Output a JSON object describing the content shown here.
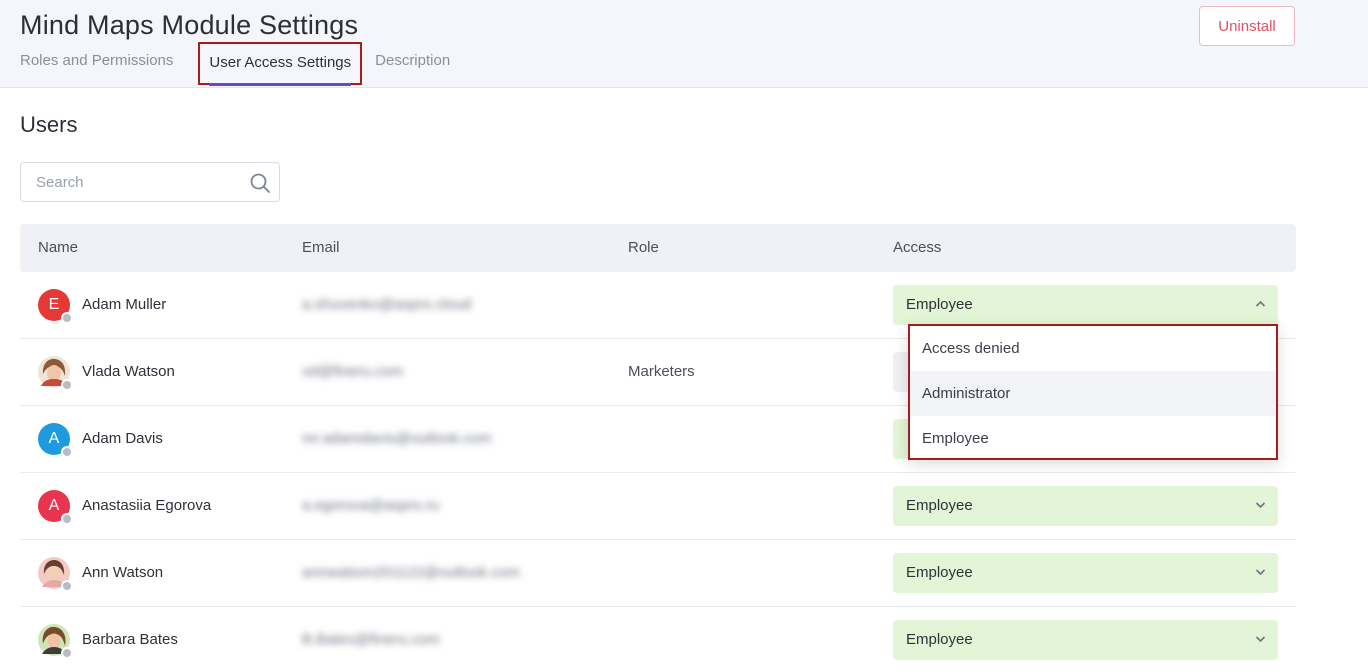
{
  "header": {
    "title": "Mind Maps Module Settings",
    "uninstall_label": "Uninstall",
    "tabs": [
      {
        "label": "Roles and Permissions",
        "active": false
      },
      {
        "label": "User Access Settings",
        "active": true
      },
      {
        "label": "Description",
        "active": false
      }
    ]
  },
  "users_section": {
    "title": "Users",
    "search_placeholder": "Search"
  },
  "table": {
    "columns": [
      "Name",
      "Email",
      "Role",
      "Access"
    ],
    "rows": [
      {
        "name": "Adam Muller",
        "avatar_letter": "E",
        "avatar_color": "#e53935",
        "email": "a.shuvenko@aspro.cloud",
        "role": "",
        "access": "Employee"
      },
      {
        "name": "Vlada Watson",
        "avatar_letter": "",
        "avatar_color": "#d9a38a",
        "email": "vd@fineru.com",
        "role": "Marketers",
        "access": ""
      },
      {
        "name": "Adam Davis",
        "avatar_letter": "A",
        "avatar_color": "#1e9be0",
        "email": "mr.adamdavis@outlook.com",
        "role": "",
        "access": ""
      },
      {
        "name": "Anastasiia Egorova",
        "avatar_letter": "A",
        "avatar_color": "#e8344e",
        "email": "a.egorova@aspro.ru",
        "role": "",
        "access": "Employee"
      },
      {
        "name": "Ann Watson",
        "avatar_letter": "",
        "avatar_color": "#e8a0a0",
        "email": "annwatson201122@outlook.com",
        "role": "",
        "access": "Employee"
      },
      {
        "name": "Barbara Bates",
        "avatar_letter": "",
        "avatar_color": "#8a6a4a",
        "email": "B.Bates@fineru.com",
        "role": "",
        "access": "Employee"
      }
    ]
  },
  "dropdown": {
    "options": [
      "Access denied",
      "Administrator",
      "Employee"
    ],
    "hovered": "Administrator"
  },
  "colors": {
    "accent_tab_underline": "#6c4bb8",
    "highlight_border": "#a71d1d",
    "uninstall_text": "#e05266",
    "access_bg": "#e3f5d7"
  }
}
